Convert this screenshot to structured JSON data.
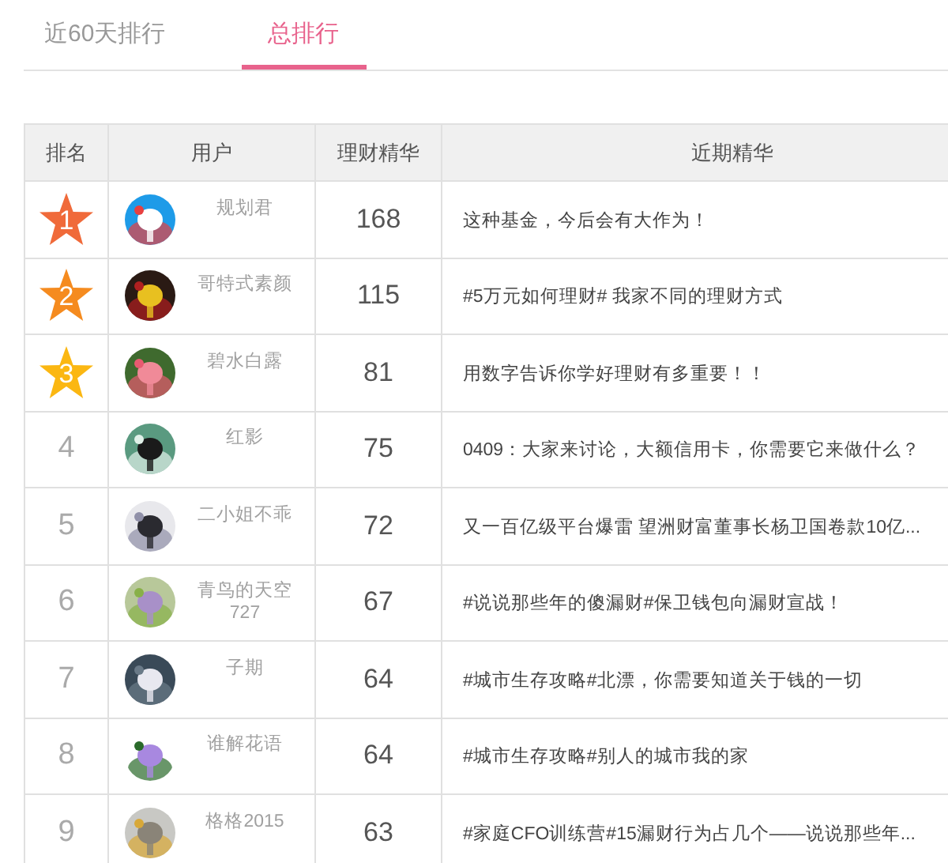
{
  "tabs": [
    {
      "label": "近60天排行",
      "selected": false
    },
    {
      "label": "总排行",
      "selected": true
    }
  ],
  "table": {
    "columns": [
      "排名",
      "用户",
      "理财精华",
      "近期精华"
    ],
    "rows": [
      {
        "rank": {
          "kind": "star",
          "label": "1",
          "color": "#f06a3a"
        },
        "user": "规划君",
        "score": "168",
        "recent": "这种基金，今后会有大作为！"
      },
      {
        "rank": {
          "kind": "star",
          "label": "2",
          "color": "#f58b1f"
        },
        "user": "哥特式素颜",
        "score": "115",
        "recent": "#5万元如何理财# 我家不同的理财方式"
      },
      {
        "rank": {
          "kind": "star",
          "label": "3",
          "color": "#fbb712"
        },
        "user": "碧水白露",
        "score": "81",
        "recent": "用数字告诉你学好理财有多重要！！"
      },
      {
        "rank": {
          "kind": "number",
          "label": "4"
        },
        "user": "红影",
        "score": "75",
        "recent": "0409：大家来讨论，大额信用卡，你需要它来做什么？"
      },
      {
        "rank": {
          "kind": "number",
          "label": "5"
        },
        "user": "二小姐不乖",
        "score": "72",
        "recent": "又一百亿级平台爆雷 望洲财富董事长杨卫国卷款10亿..."
      },
      {
        "rank": {
          "kind": "number",
          "label": "6"
        },
        "user": "青鸟的天空727",
        "score": "67",
        "recent": "#说说那些年的傻漏财#保卫钱包向漏财宣战！"
      },
      {
        "rank": {
          "kind": "number",
          "label": "7"
        },
        "user": "子期",
        "score": "64",
        "recent": "#城市生存攻略#北漂，你需要知道关于钱的一切"
      },
      {
        "rank": {
          "kind": "number",
          "label": "8"
        },
        "user": "谁解花语",
        "score": "64",
        "recent": "#城市生存攻略#别人的城市我的家"
      },
      {
        "rank": {
          "kind": "number",
          "label": "9"
        },
        "user": "格格2015",
        "score": "63",
        "recent": "#家庭CFO训练营#15漏财行为占几个——说说那些年..."
      }
    ]
  }
}
